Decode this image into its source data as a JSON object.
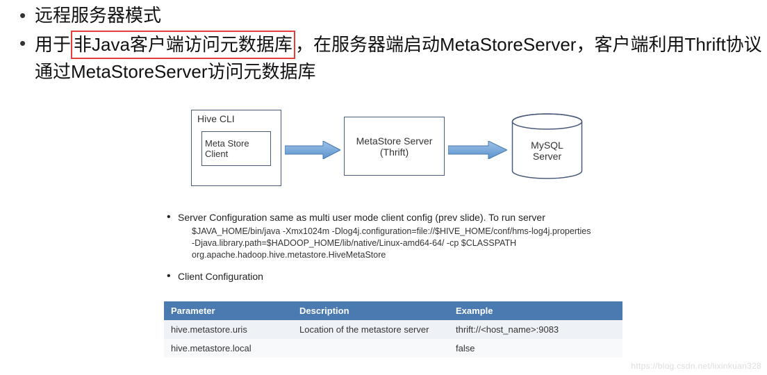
{
  "bullets": {
    "b1": "远程服务器模式",
    "b2_pre": "用于",
    "b2_highlight": "非Java客户端访问元数据库",
    "b2_post": "，在服务器端启动MetaStoreServer，客户端利用Thrift协议通过MetaStoreServer访问元数据库"
  },
  "diagram": {
    "hive_cli": "Hive CLI",
    "metastore_client": "Meta Store Client",
    "metastore_server_l1": "MetaStore Server",
    "metastore_server_l2": "(Thrift)",
    "mysql_l1": "MySQL",
    "mysql_l2": "Server"
  },
  "config": {
    "server_heading": "Server Configuration same as multi user mode client config (prev slide). To run server",
    "code1": "$JAVA_HOME/bin/java -Xmx1024m -Dlog4j.configuration=file://$HIVE_HOME/conf/hms-log4j.properties",
    "code2": "-Djava.library.path=$HADOOP_HOME/lib/native/Linux-amd64-64/ -cp $CLASSPATH",
    "code3": "org.apache.hadoop.hive.metastore.HiveMetaStore",
    "client_heading": "Client Configuration"
  },
  "table": {
    "headers": {
      "h1": "Parameter",
      "h2": "Description",
      "h3": "Example"
    },
    "rows": [
      {
        "p": "hive.metastore.uris",
        "d": "Location of the metastore server",
        "e": "thrift://<host_name>:9083"
      },
      {
        "p": "hive.metastore.local",
        "d": "",
        "e": "false"
      }
    ]
  },
  "watermark": "https://blog.csdn.net/lixinkuan328"
}
